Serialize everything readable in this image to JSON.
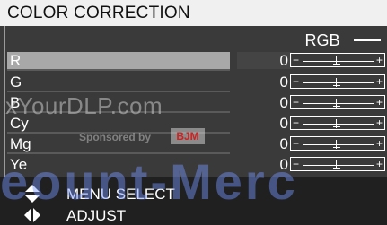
{
  "menu": {
    "title": "COLOR CORRECTION",
    "mode": "RGB",
    "rows": [
      {
        "label": "R",
        "value": "0",
        "selected": true
      },
      {
        "label": "G",
        "value": "0"
      },
      {
        "label": "B",
        "value": "0"
      },
      {
        "label": "Cy",
        "value": "0"
      },
      {
        "label": "Mg",
        "value": "0"
      },
      {
        "label": "Ye",
        "value": "0"
      }
    ],
    "slider_minus": "−",
    "slider_plus": "+"
  },
  "hints": {
    "menu_select": "MENU SELECT",
    "adjust": "ADJUST"
  },
  "watermark": {
    "site": "xYourDLP.com",
    "sponsored": "Sponsored by",
    "logo": "BJM",
    "big": "eount-Merc"
  }
}
